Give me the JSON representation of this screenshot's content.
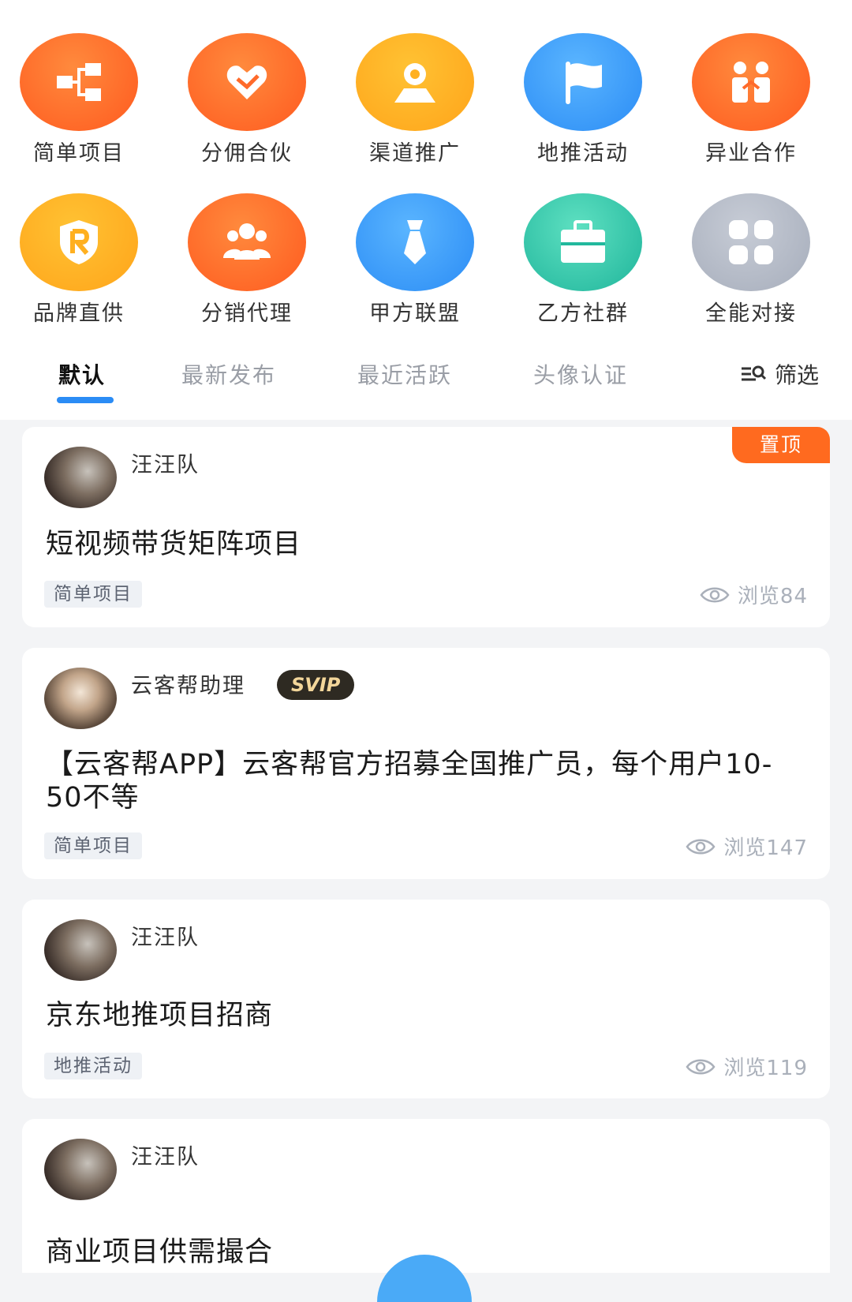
{
  "categories": [
    {
      "label": "简单项目",
      "icon": "org-chart-icon"
    },
    {
      "label": "分佣合伙",
      "icon": "handshake-heart-icon"
    },
    {
      "label": "渠道推广",
      "icon": "user-location-icon"
    },
    {
      "label": "地推活动",
      "icon": "flag-icon"
    },
    {
      "label": "异业合作",
      "icon": "people-partner-icon"
    },
    {
      "label": "品牌直供",
      "icon": "brand-shield-icon"
    },
    {
      "label": "分销代理",
      "icon": "group-icon"
    },
    {
      "label": "甲方联盟",
      "icon": "tie-icon"
    },
    {
      "label": "乙方社群",
      "icon": "briefcase-icon"
    },
    {
      "label": "全能对接",
      "icon": "grid-apps-icon"
    }
  ],
  "tabs": [
    "默认",
    "最新发布",
    "最近活跃",
    "头像认证"
  ],
  "filter_label": "筛选",
  "pin_label": "置顶",
  "svip_label": "SVIP",
  "posts": [
    {
      "author": "汪汪队",
      "title": "短视频带货矩阵项目",
      "tag": "简单项目",
      "views": "浏览84"
    },
    {
      "author": "云客帮助理",
      "title": "【云客帮APP】云客帮官方招募全国推广员，每个用户10-50不等",
      "tag": "简单项目",
      "views": "浏览147"
    },
    {
      "author": "汪汪队",
      "title": "京东地推项目招商",
      "tag": "地推活动",
      "views": "浏览119"
    },
    {
      "author": "汪汪队",
      "title": "商业项目供需撮合"
    }
  ],
  "colors": {
    "accent": "#2b8cf5",
    "pin": "#ff6a1f",
    "orange": "#ff5a1f"
  }
}
